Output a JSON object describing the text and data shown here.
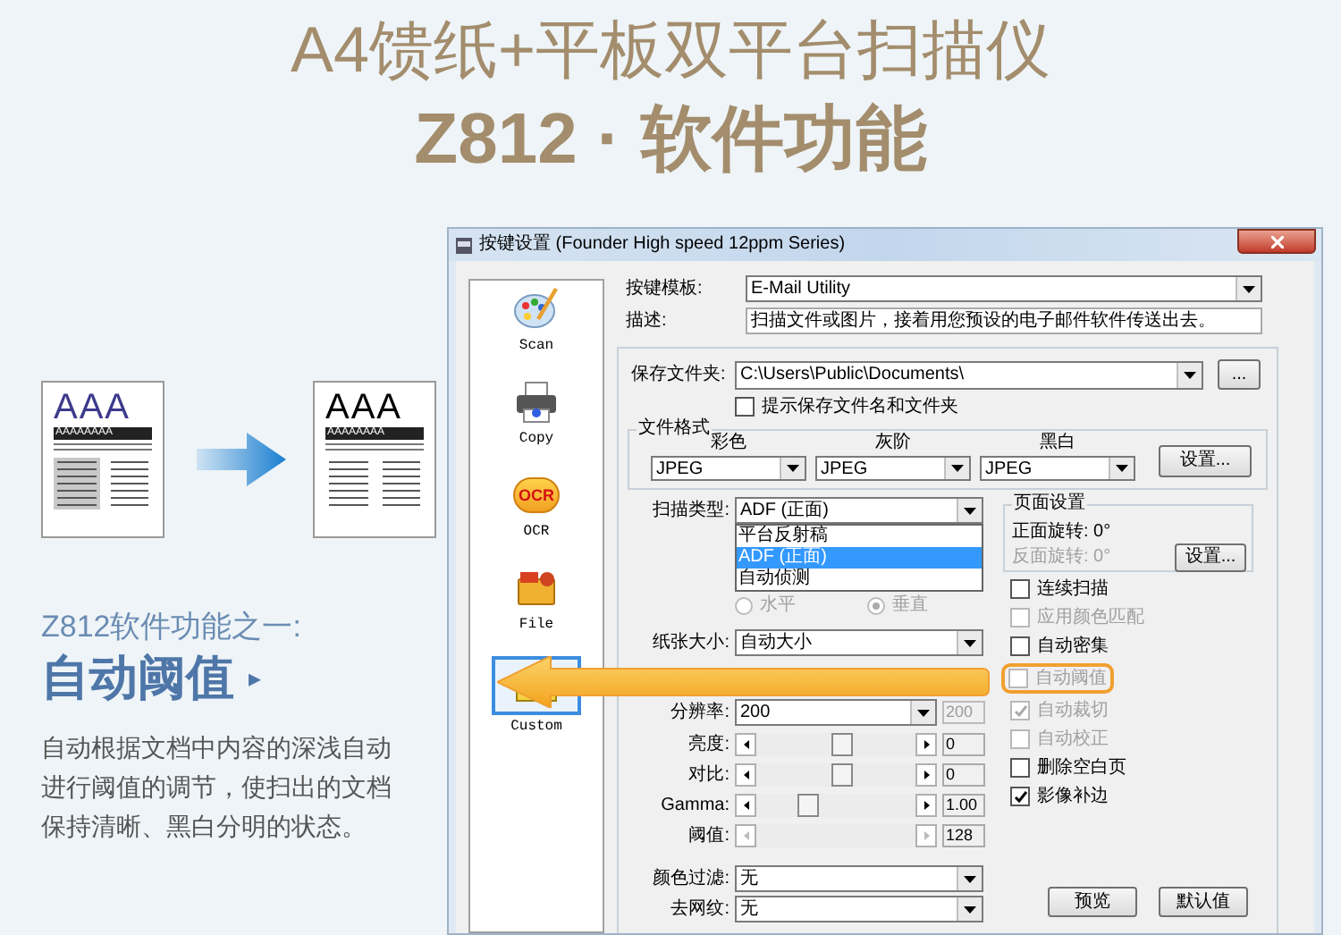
{
  "heading": {
    "line1": "A4馈纸+平板双平台扫描仪",
    "line2": "Z812 · 软件功能"
  },
  "illustration": {
    "before": {
      "big": "AAA",
      "band": "AAAAAAAA"
    },
    "after": {
      "big": "AAA",
      "band": "AAAAAAAA"
    }
  },
  "feature": {
    "subtitle": "Z812软件功能之一:",
    "title": "自动阈值",
    "marker": "▸",
    "description": "自动根据文档中内容的深浅自动进行阈值的调节，使扫出的文档保持清晰、黑白分明的状态。"
  },
  "window": {
    "title": "按键设置 (Founder High speed 12ppm Series)",
    "sidebar": [
      {
        "kind": "palette",
        "label": "Scan",
        "selected": false
      },
      {
        "kind": "printer",
        "label": "Copy",
        "selected": false
      },
      {
        "kind": "ocr",
        "label": "OCR",
        "badge": "OCR",
        "selected": false
      },
      {
        "kind": "file",
        "label": "File",
        "selected": false
      },
      {
        "kind": "custom",
        "label": "Custom",
        "selected": true
      }
    ],
    "template": {
      "label": "按键模板:",
      "value": "E-Mail Utility"
    },
    "description": {
      "label": "描述:",
      "value": "扫描文件或图片，接着用您预设的电子邮件软件传送出去。"
    },
    "save_folder": {
      "label": "保存文件夹:",
      "value": "C:\\Users\\Public\\Documents\\",
      "browse": "..."
    },
    "prompt_checkbox": {
      "label": "提示保存文件名和文件夹",
      "checked": false
    },
    "file_format": {
      "title": "文件格式",
      "columns": [
        {
          "header": "彩色",
          "value": "JPEG"
        },
        {
          "header": "灰阶",
          "value": "JPEG"
        },
        {
          "header": "黑白",
          "value": "JPEG"
        }
      ],
      "button": "设置..."
    },
    "scan_type": {
      "label": "扫描类型:",
      "value": "ADF (正面)",
      "options": [
        {
          "label": "平台反射稿",
          "selected": false
        },
        {
          "label": "ADF (正面)",
          "selected": true
        },
        {
          "label": "自动侦测",
          "selected": false
        }
      ]
    },
    "orientation": {
      "disabled": true,
      "options": [
        {
          "label": "水平",
          "selected": false
        },
        {
          "label": "垂直",
          "selected": true
        }
      ]
    },
    "paper_size": {
      "label": "纸张大小:",
      "value": "自动大小"
    },
    "resolution": {
      "label": "分辨率:",
      "value": "200",
      "field": "200"
    },
    "sliders": [
      {
        "label": "亮度:",
        "level": 0.55,
        "value": "0",
        "disabled": false
      },
      {
        "label": "对比:",
        "level": 0.55,
        "value": "0",
        "disabled": false
      },
      {
        "label": "Gamma:",
        "level": 0.3,
        "value": "1.00",
        "disabled": false
      },
      {
        "label": "阈值:",
        "value": "128",
        "disabled": true
      }
    ],
    "color_filter": {
      "label": "颜色过滤:",
      "value": "无"
    },
    "descreen": {
      "label": "去网纹:",
      "value": "无"
    },
    "page_setup": {
      "title": "页面设置",
      "front": {
        "text": "正面旋转: 0°",
        "disabled": false
      },
      "back": {
        "text": "反面旋转: 0°",
        "disabled": true
      },
      "button": "设置..."
    },
    "options": [
      {
        "label": "连续扫描",
        "checked": false,
        "disabled": false,
        "highlighted": false
      },
      {
        "label": "应用颜色匹配",
        "checked": false,
        "disabled": true,
        "highlighted": false
      },
      {
        "label": "自动密集",
        "checked": false,
        "disabled": false,
        "highlighted": false
      },
      {
        "label": "自动阈值",
        "checked": false,
        "disabled": true,
        "highlighted": true
      },
      {
        "label": "自动裁切",
        "checked": true,
        "disabled": true,
        "highlighted": false
      },
      {
        "label": "自动校正",
        "checked": false,
        "disabled": true,
        "highlighted": false
      },
      {
        "label": "删除空白页",
        "checked": false,
        "disabled": false,
        "highlighted": false
      },
      {
        "label": "影像补边",
        "checked": true,
        "disabled": false,
        "highlighted": false
      }
    ],
    "buttons": [
      "预览",
      "默认值"
    ]
  }
}
